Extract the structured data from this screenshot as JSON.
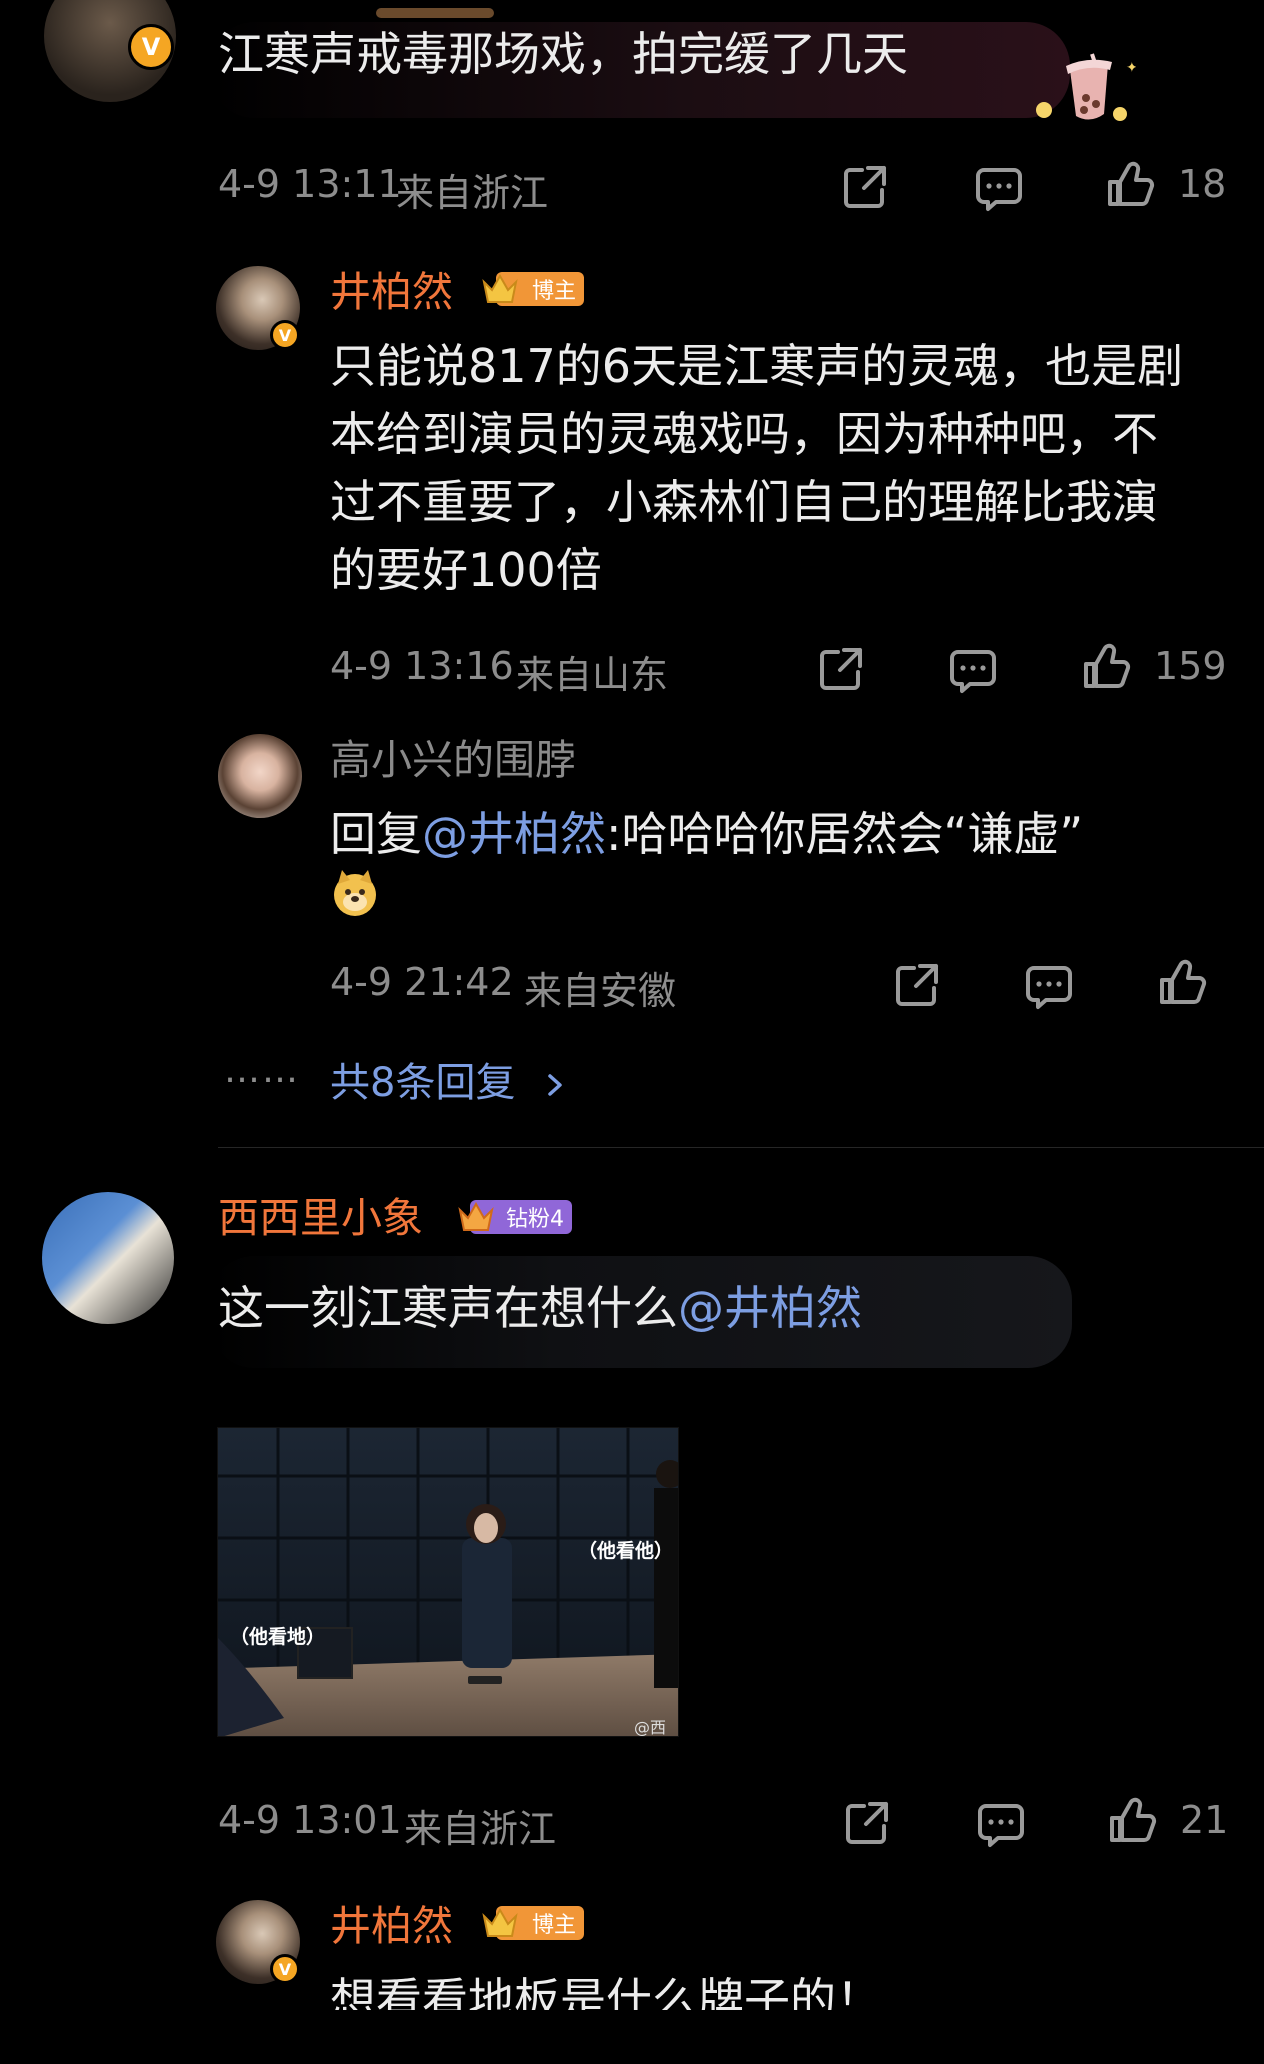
{
  "top_comment": {
    "text": "江寒声戒毒那场戏，拍完缓了几天",
    "time": "4-9 13:11",
    "location": "来自浙江",
    "likes": "18"
  },
  "reply_1": {
    "user": "井柏然",
    "badge": "博主",
    "text": "只能说817的6天是江寒声的灵魂，也是剧本给到演员的灵魂戏吗，因为种种吧，不过不重要了，小森林们自己的理解比我演的要好100倍",
    "time": "4-9 13:16",
    "location": "来自山东",
    "likes": "159"
  },
  "reply_2": {
    "user": "高小兴的围脖",
    "prefix": "回复",
    "mention": "@井柏然",
    "text": ":哈哈哈你居然会“谦虚”",
    "time": "4-9 21:42",
    "location": "来自安徽"
  },
  "more_replies": {
    "dots": "……",
    "label": "共8条回复"
  },
  "comment_2": {
    "user": "西西里小象",
    "badge": "钻粉4",
    "text": "这一刻江寒声在想什么",
    "mention": "@井柏然",
    "image_caption_left": "（他看地）",
    "image_caption_right": "（他看他）",
    "watermark": "@西",
    "time": "4-9 13:01",
    "location": "来自浙江",
    "likes": "21"
  },
  "reply_3": {
    "user": "井柏然",
    "badge": "博主",
    "text": "想看看地板是什么牌子的！"
  },
  "colors": {
    "background": "#000000",
    "name_orange": "#f1763b",
    "mention_blue": "#7d9ee2",
    "meta_grey": "#8d8d8d",
    "verified": "#f5a623"
  }
}
